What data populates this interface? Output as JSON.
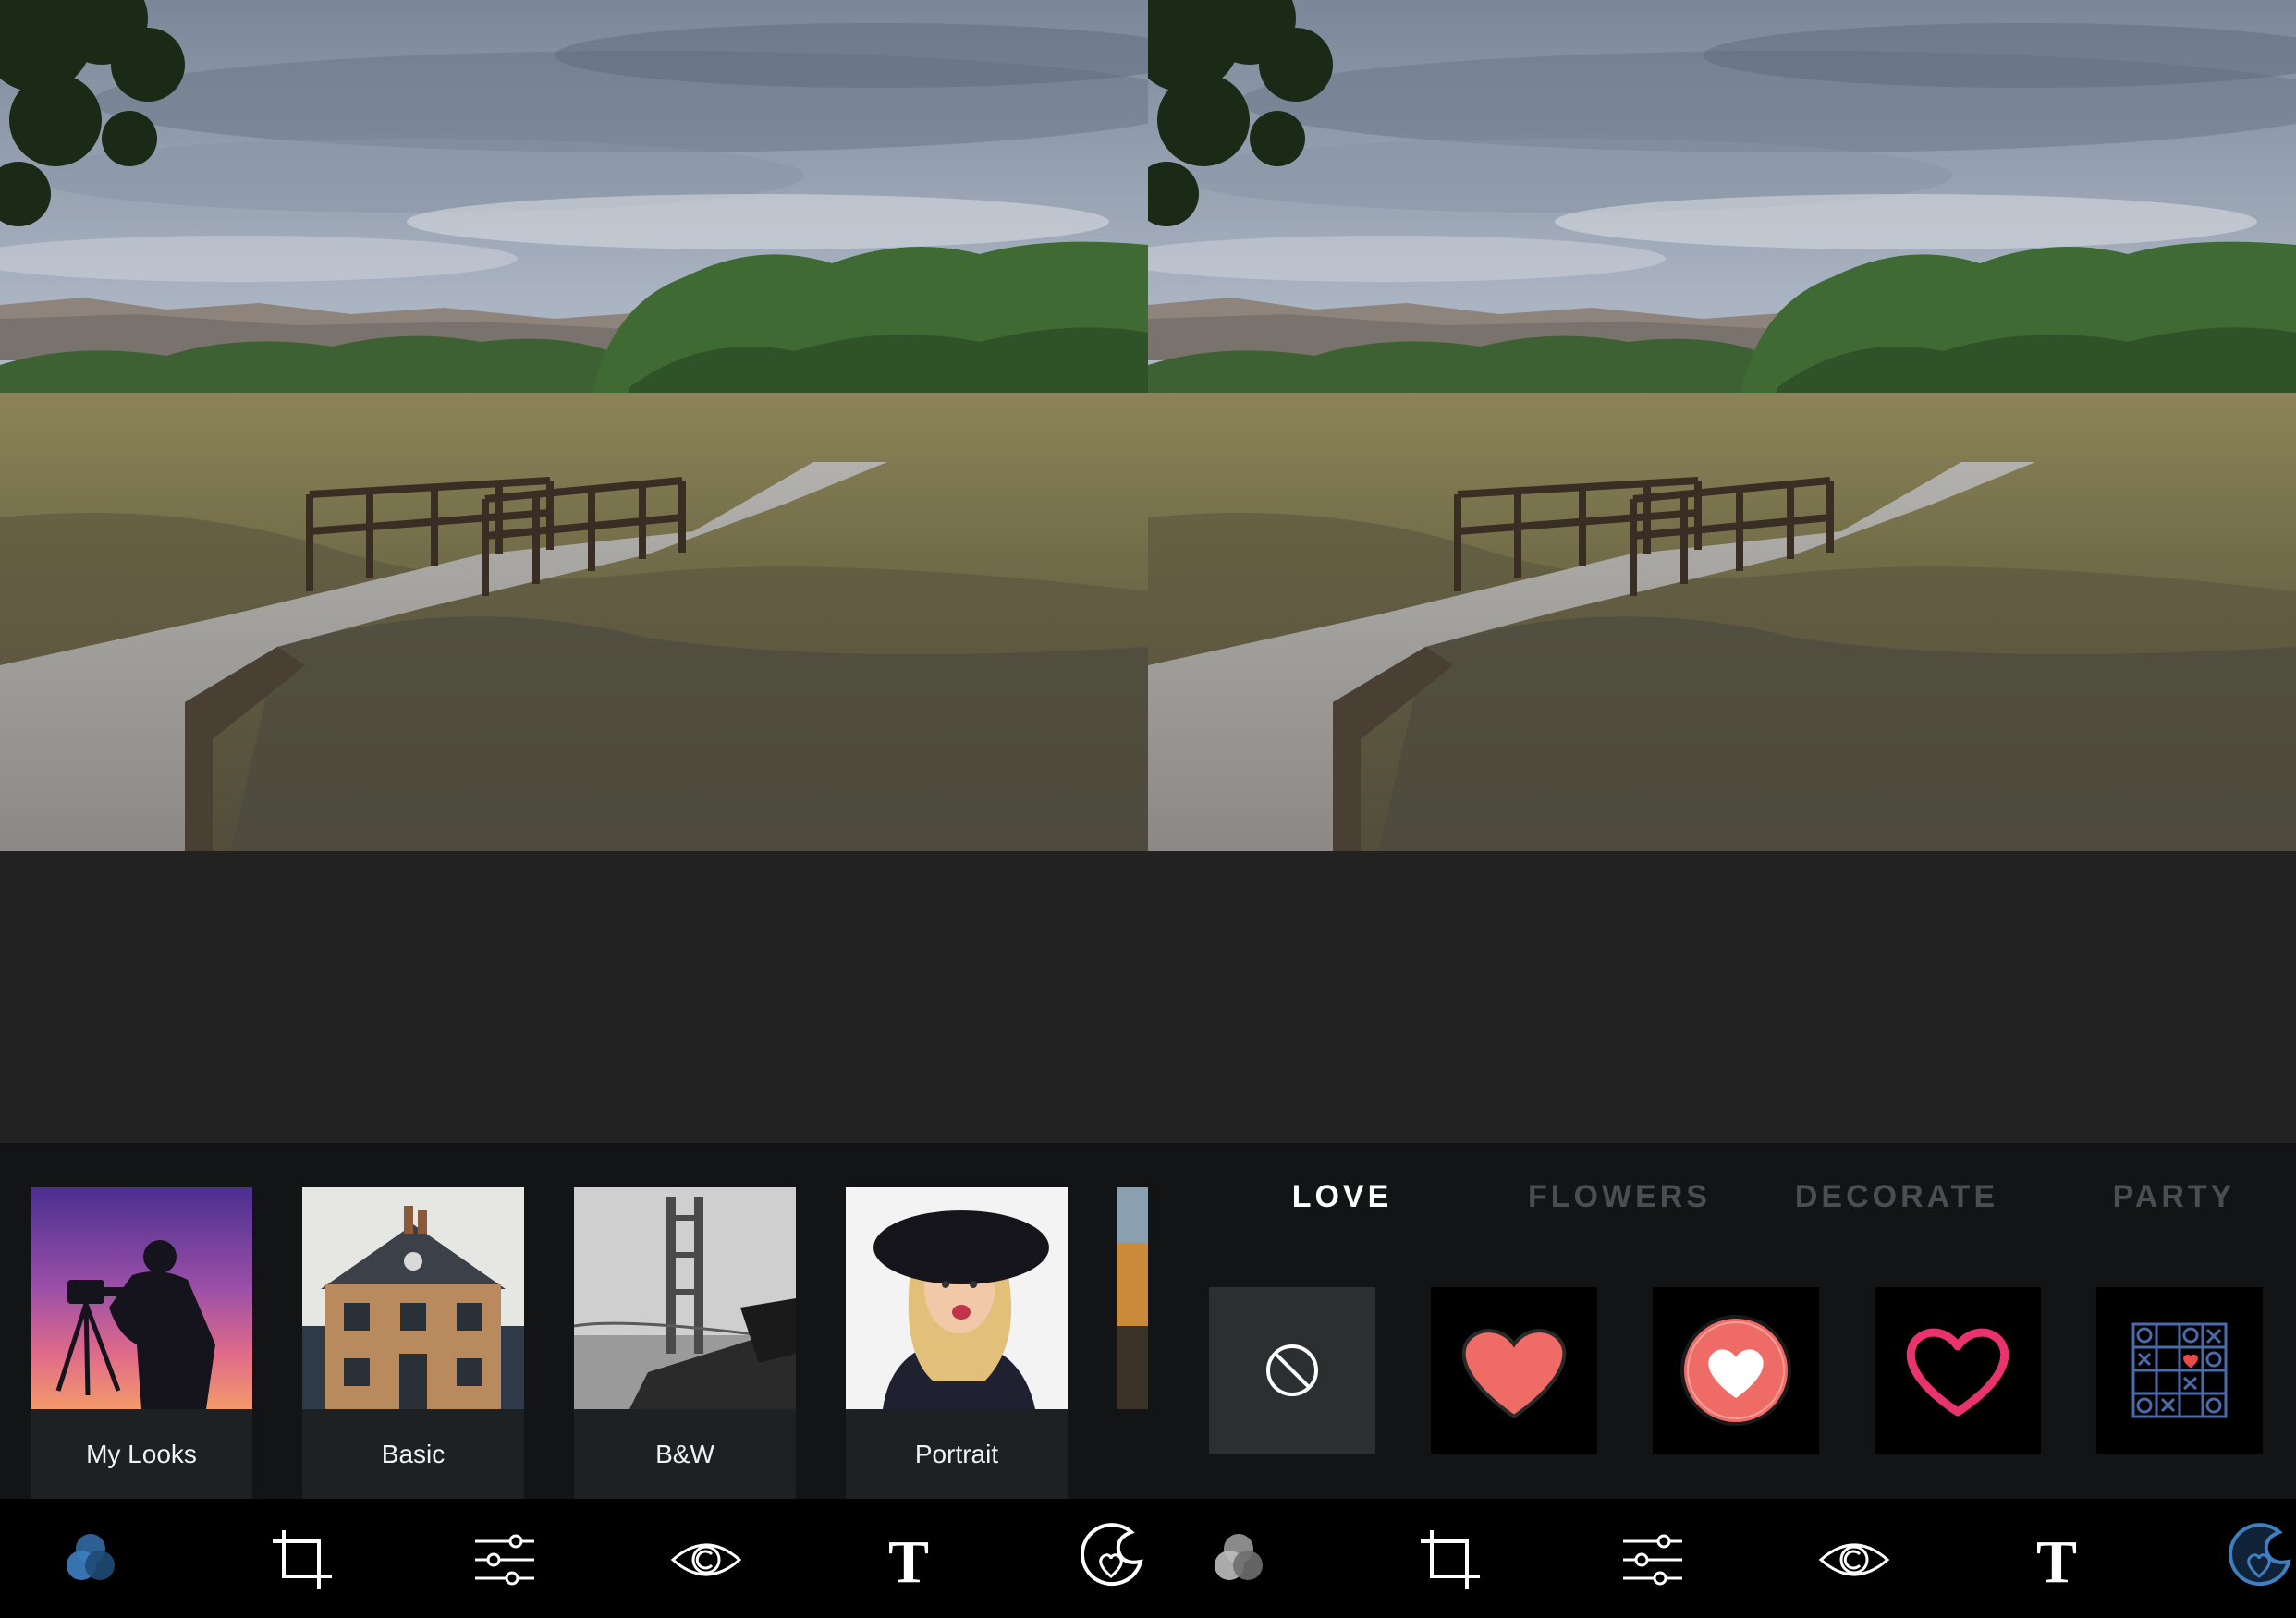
{
  "left_panel": {
    "looks": [
      {
        "label": "My Looks"
      },
      {
        "label": "Basic"
      },
      {
        "label": "B&W"
      },
      {
        "label": "Portrait"
      }
    ]
  },
  "right_panel": {
    "sticker_tabs": [
      {
        "label": "LOVE",
        "active": true
      },
      {
        "label": "FLOWERS",
        "active": false
      },
      {
        "label": "DECORATE",
        "active": false
      },
      {
        "label": "PARTY",
        "active": false
      }
    ],
    "stickers": [
      {
        "icon": "no-sticker-icon"
      },
      {
        "icon": "heart-sticker-icon"
      },
      {
        "icon": "heart-circle-sticker-icon"
      },
      {
        "icon": "heart-outline-sticker-icon"
      },
      {
        "icon": "tic-tac-toe-heart-sticker-icon"
      }
    ]
  },
  "toolbar_icons": [
    "looks-icon",
    "crop-icon",
    "adjust-sliders-icon",
    "eye-icon",
    "text-icon",
    "sticker-icon"
  ],
  "colors": {
    "accent_blue": "#3d7fc1",
    "heart_coral": "#ef6b66",
    "heart_pink": "#e8336e",
    "tab_inactive": "#4a4e52",
    "toolbar_bg": "#000000",
    "strip_bg": "#121416",
    "canvas_bg": "#222222"
  }
}
